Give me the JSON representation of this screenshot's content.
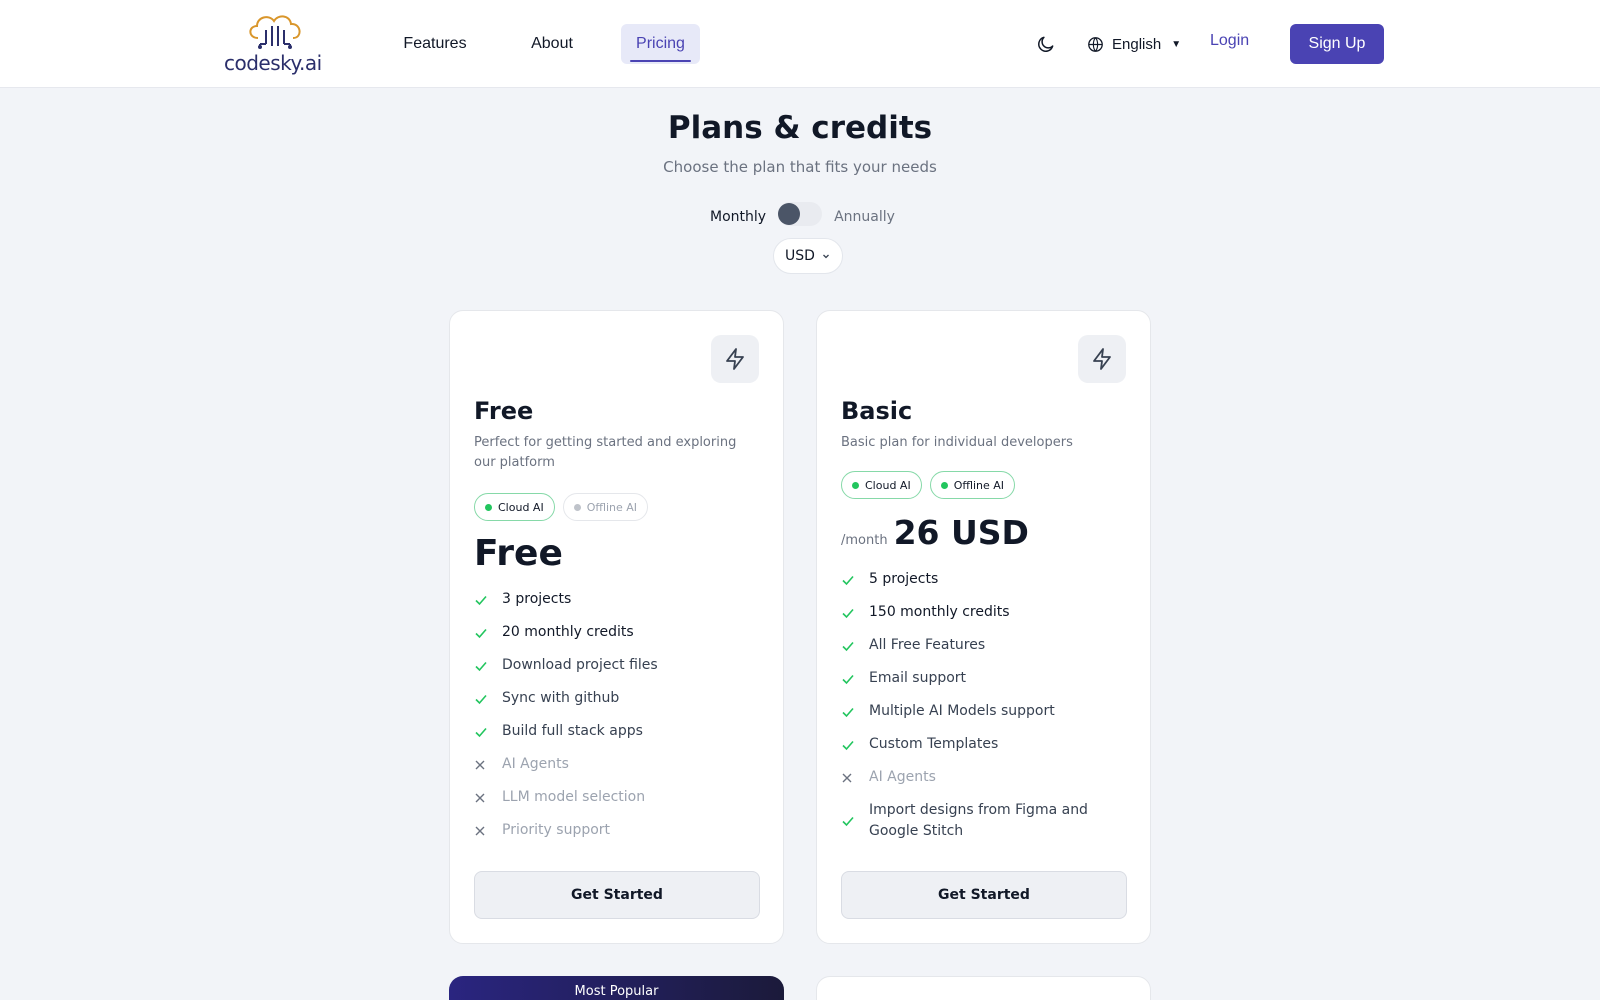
{
  "header": {
    "logo_text": "codesky.ai",
    "nav": {
      "features": "Features",
      "about": "About",
      "pricing": "Pricing"
    },
    "language": "English",
    "login": "Login",
    "signup": "Sign Up"
  },
  "hero": {
    "title": "Plans & credits",
    "subtitle": "Choose the plan that fits your needs",
    "billing": {
      "monthly": "Monthly",
      "annually": "Annually",
      "annual_selected": false
    },
    "currency": "USD"
  },
  "plans": [
    {
      "name": "Free",
      "description": "Perfect for getting started and exploring our platform",
      "badges": [
        {
          "label": "Cloud AI",
          "active": true
        },
        {
          "label": "Offline AI",
          "active": false
        }
      ],
      "price": "Free",
      "features": [
        {
          "text": "3 projects",
          "included": true
        },
        {
          "text": "20 monthly credits",
          "included": true
        },
        {
          "text": "Download project files",
          "included": true
        },
        {
          "text": "Sync with github",
          "included": true
        },
        {
          "text": "Build full stack apps",
          "included": true
        },
        {
          "text": "AI Agents",
          "included": false
        },
        {
          "text": "LLM model selection",
          "included": false
        },
        {
          "text": "Priority support",
          "included": false
        }
      ],
      "cta": "Get Started"
    },
    {
      "name": "Basic",
      "description": "Basic plan for individual developers",
      "badges": [
        {
          "label": "Cloud AI",
          "active": true
        },
        {
          "label": "Offline AI",
          "active": true
        }
      ],
      "price_period": "/month",
      "price": "26 USD",
      "features": [
        {
          "text": "5 projects",
          "included": true
        },
        {
          "text": "150 monthly credits",
          "included": true
        },
        {
          "text": "All Free Features",
          "included": true
        },
        {
          "text": "Email support",
          "included": true
        },
        {
          "text": "Multiple AI Models support",
          "included": true
        },
        {
          "text": "Custom Templates",
          "included": true
        },
        {
          "text": "AI Agents",
          "included": false
        },
        {
          "text": "Import designs from Figma and Google Stitch",
          "included": true
        }
      ],
      "cta": "Get Started"
    }
  ],
  "popular_label": "Most Popular",
  "colors": {
    "accent": "#4a43b3",
    "check": "#22c55e",
    "muted": "#9ca3af"
  }
}
